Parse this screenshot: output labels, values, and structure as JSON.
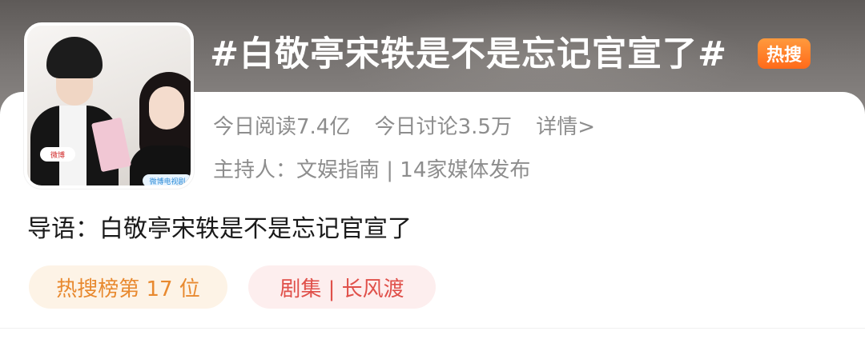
{
  "topic": {
    "title": "#白敬亭宋轶是不是忘记官宣了#",
    "badge": "热搜"
  },
  "cover": {
    "weibo_tag": "微博",
    "tv_tag": "微博电视剧"
  },
  "stats": {
    "read": "今日阅读7.4亿",
    "discuss": "今日讨论3.5万",
    "details": "详情>"
  },
  "host": {
    "text": "主持人：文娱指南 | 14家媒体发布"
  },
  "intro": {
    "text": "导语：白敬亭宋轶是不是忘记官宣了"
  },
  "tags": [
    {
      "label": "热搜榜第 17 位"
    },
    {
      "label": "剧集 | 长风渡"
    }
  ],
  "colors": {
    "badge": "#ff7a22",
    "rank_tag_text": "#e8892f",
    "show_tag_text": "#e0504a",
    "meta_text": "#8d8d8d"
  }
}
